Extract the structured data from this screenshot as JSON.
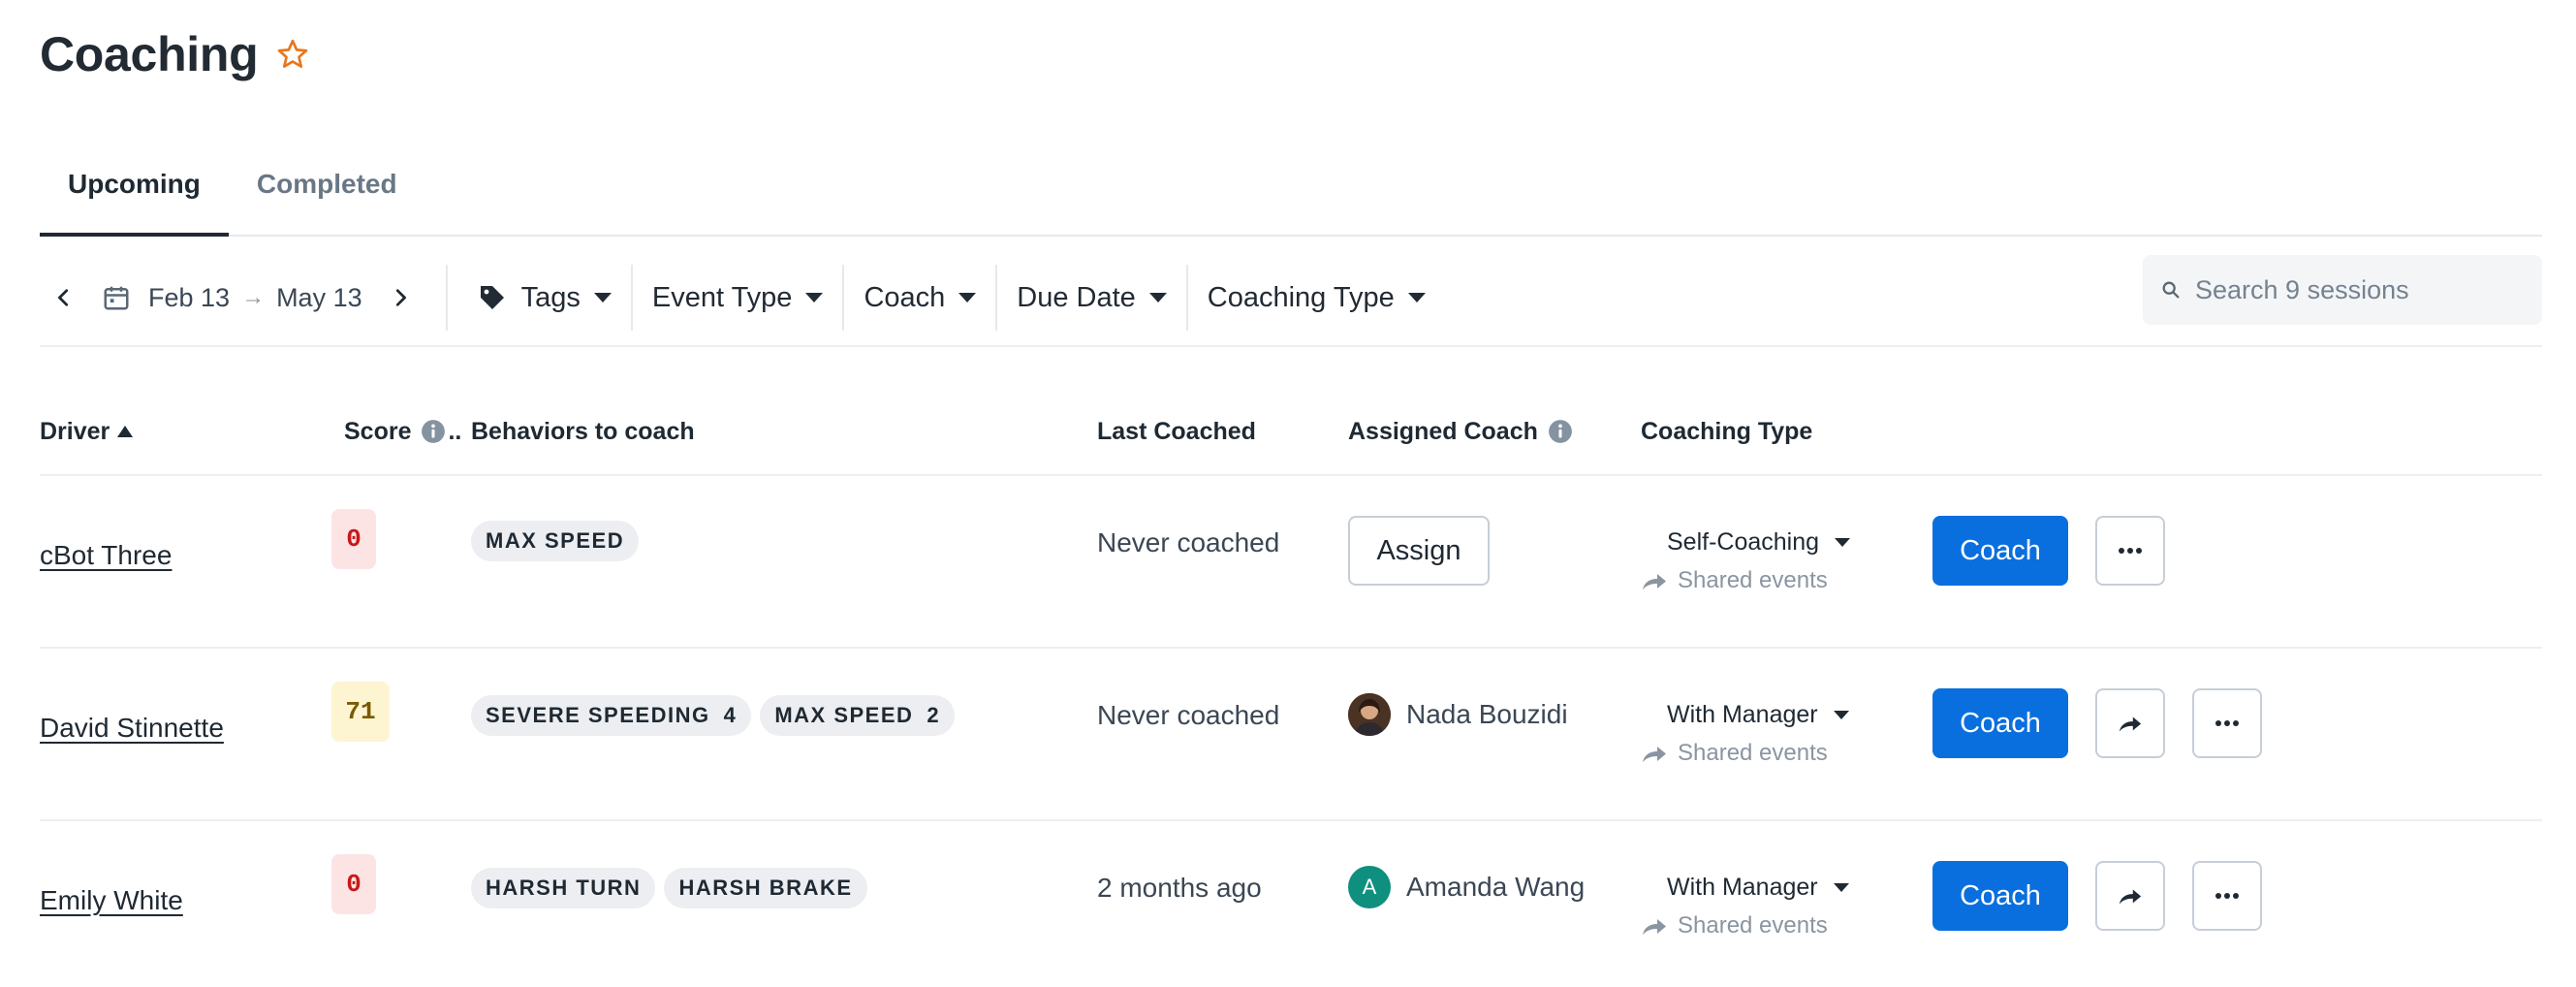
{
  "header": {
    "title": "Coaching"
  },
  "tabs": [
    {
      "label": "Upcoming",
      "active": true
    },
    {
      "label": "Completed",
      "active": false
    }
  ],
  "filters": {
    "date_start": "Feb 13",
    "date_arrow": "→",
    "date_end": "May 13",
    "tags": "Tags",
    "event_type": "Event Type",
    "coach": "Coach",
    "due_date": "Due Date",
    "coaching_type": "Coaching Type",
    "search_placeholder": "Search 9 sessions"
  },
  "table": {
    "columns": {
      "driver": "Driver",
      "score": "Score",
      "score_more": "..",
      "behaviors": "Behaviors to coach",
      "last_coached": "Last Coached",
      "assigned_coach": "Assigned Coach",
      "coaching_type": "Coaching Type"
    },
    "rows": [
      {
        "driver": "cBot Three",
        "score": "0",
        "behaviors": [
          {
            "label": "MAX SPEED",
            "count": ""
          }
        ],
        "last_coached": "Never coached",
        "assign_label": "Assign",
        "coaching_type": "Self-Coaching",
        "shared": "Shared events",
        "coach_label": "Coach"
      },
      {
        "driver": "David Stinnette",
        "score": "71",
        "behaviors": [
          {
            "label": "SEVERE SPEEDING",
            "count": "4"
          },
          {
            "label": "MAX SPEED",
            "count": "2"
          }
        ],
        "last_coached": "Never coached",
        "coach_name": "Nada Bouzidi",
        "coaching_type": "With Manager",
        "shared": "Shared events",
        "coach_label": "Coach"
      },
      {
        "driver": "Emily White",
        "score": "0",
        "behaviors": [
          {
            "label": "HARSH TURN",
            "count": ""
          },
          {
            "label": "HARSH BRAKE",
            "count": ""
          }
        ],
        "last_coached": "2 months ago",
        "coach_name": "Amanda Wang",
        "coach_initial": "A",
        "coaching_type": "With Manager",
        "shared": "Shared events",
        "coach_label": "Coach"
      }
    ]
  },
  "colors": {
    "primary": "#0a6fde",
    "star": "#e8771e",
    "score_red": "#c81818",
    "score_yellow_bg": "#fdf5d2",
    "avatar_teal": "#0f8f7e"
  },
  "icons": [
    "star-icon",
    "chevron-left-icon",
    "calendar-icon",
    "chevron-right-icon",
    "tag-icon",
    "search-icon",
    "info-icon",
    "share-arrow-icon",
    "forward-icon",
    "more-icon"
  ]
}
